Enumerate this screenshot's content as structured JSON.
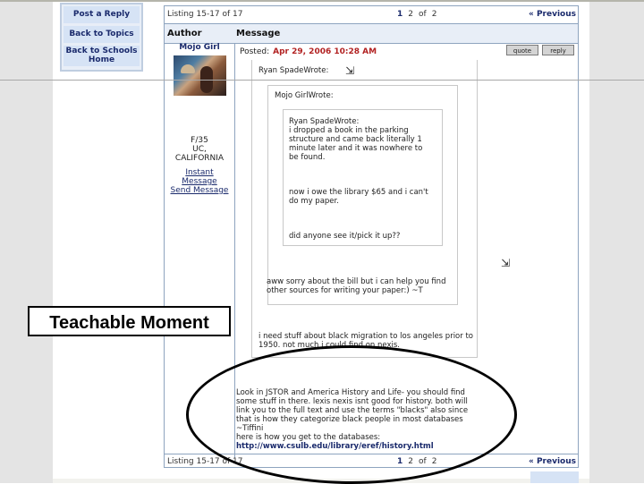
{
  "nav": {
    "post_reply": "Post a Reply",
    "back_topics": "Back to Topics",
    "back_schools": "Back to Schools Home"
  },
  "listing": {
    "top_text": "Listing 15-17 of 17",
    "bottom_text": "Listing 15-17 of 17",
    "page_current": "1",
    "page_next": "2",
    "of_label": "of",
    "page_total": "2",
    "previous": "« Previous"
  },
  "header": {
    "author": "Author",
    "message": "Message"
  },
  "post": {
    "author": "Mojo Girl",
    "author_info": [
      "F/35",
      "UC,",
      "CALIFORNIA"
    ],
    "instant_message": "Instant Message",
    "send_message": "Send Message",
    "posted_label": "Posted:",
    "posted_date": "Apr 29, 2006 10:28 AM",
    "quote_btn": "quote",
    "reply_btn": "reply",
    "quote1_header": "Ryan SpadeWrote:",
    "quote2_header": "Mojo GirlWrote:",
    "quote3_header": "Ryan SpadeWrote:",
    "quote3_body1": "i dropped a book in the parking structure and came back literally 1 minute later and it was nowhere to be found.",
    "quote3_body2": "now i owe the library $65 and i can't do my paper.",
    "quote3_body3": "did anyone see it/pick it up??",
    "quote2_body": "aww sorry about the bill but i can help you find other sources for writing your paper:) ~T",
    "quote1_body": "i need stuff about black migration to los angeles prior to 1950. not much i could find on nexis.",
    "reply_body": "Look in JSTOR and America History and Life- you should find some stuff in there. lexis nexis isnt good for history. both will link you to the full text and use the terms \"blacks\" also since that is how they categorize black people in most databases",
    "signature": "~Tiffini",
    "db_line": "here is how you get to the databases:",
    "db_link": "http://www.csulb.edu/library/eref/history.html"
  },
  "annotation": {
    "callout": "Teachable Moment"
  }
}
